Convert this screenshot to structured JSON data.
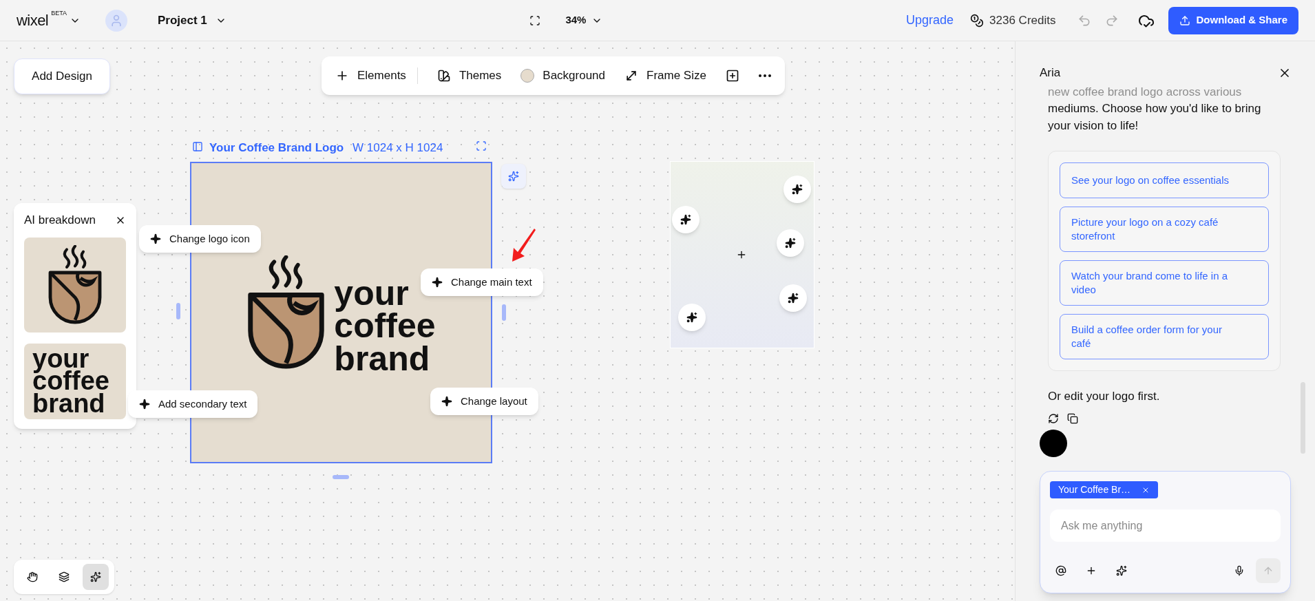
{
  "top_bar": {
    "logo": "wixel",
    "logo_badge": "BETA",
    "project": "Project 1",
    "zoom": "34%",
    "upgrade": "Upgrade",
    "credits": "3236 Credits",
    "undo_disabled": true,
    "redo_disabled": true,
    "download": "Download & Share"
  },
  "canvas": {
    "add_design": "Add Design",
    "toolbar": [
      {
        "kind": "plus",
        "label": "Elements"
      },
      {
        "kind": "themes",
        "label": "Themes"
      },
      {
        "kind": "swatch",
        "label": "Background",
        "color": "#e6dccd"
      },
      {
        "kind": "resize",
        "label": "Frame Size"
      },
      {
        "kind": "add-frame"
      },
      {
        "kind": "more"
      }
    ],
    "frame": {
      "title": "Your Coffee Brand Logo",
      "size": "W 1024 x H 1024",
      "logo_lines": [
        "your",
        "coffee",
        "brand"
      ]
    },
    "breakdown": {
      "title": "AI breakdown",
      "text_tile_lines": [
        "your",
        "coffee",
        "brand"
      ]
    },
    "chips": [
      {
        "label": "Change logo icon"
      },
      {
        "label": "Change main text"
      },
      {
        "label": "Add secondary text"
      },
      {
        "label": "Change layout"
      }
    ],
    "tools": [
      {
        "kind": "hand",
        "selected": false
      },
      {
        "kind": "layers",
        "selected": false
      },
      {
        "kind": "sparkle",
        "selected": true
      }
    ]
  },
  "chat": {
    "title": "Aria",
    "faded_text": "new coffee brand logo across various",
    "message": "mediums. Choose how you'd like to bring your vision to life!",
    "suggestions": [
      "See your logo on coffee essentials",
      "Picture your logo on a cozy café storefront",
      "Watch your brand come to life in a video",
      "Build a coffee order form for your café"
    ],
    "follow_up": "Or edit your logo first.",
    "composer": {
      "tag": "Your Coffee Br…",
      "placeholder": "Ask me anything",
      "send_disabled": true
    }
  }
}
